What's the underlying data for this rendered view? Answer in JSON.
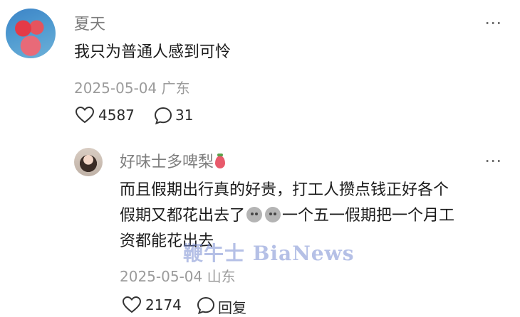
{
  "comment": {
    "author": "夏天",
    "text": "我只为普通人感到可怜",
    "date": "2025-05-04",
    "location": "广东",
    "likes": "4587",
    "replies": "31"
  },
  "reply": {
    "author": "好味士多啤梨",
    "line1": "而且假期出行真的好贵，打工人攒点钱正好各个",
    "line2_a": "假期又都花出去了",
    "line2_b": "一个五一假期把一个月工",
    "line3": "资都能花出去",
    "date": "2025-05-04",
    "location": "山东",
    "likes": "2174",
    "reply_label": "回复"
  },
  "more_icon": "⋯",
  "watermark": "鞭牛士 BiaNews"
}
